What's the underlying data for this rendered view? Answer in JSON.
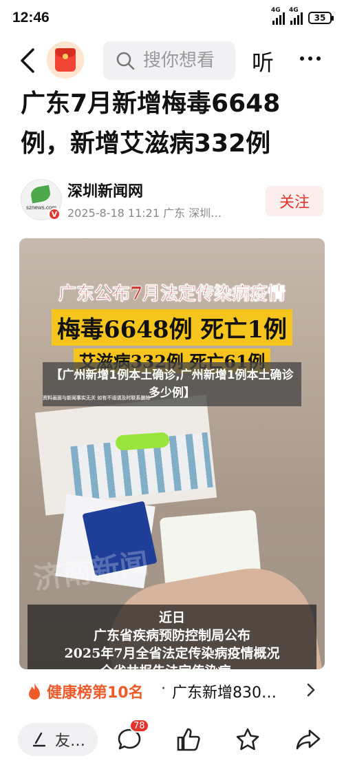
{
  "status_bar": {
    "time": "12:46",
    "network_1": "4G",
    "network_2": "4G",
    "battery": "35"
  },
  "nav": {
    "search_placeholder": "搜你想看",
    "listen_label": "听"
  },
  "article": {
    "title": "广东7月新增梅毒6648例，新增艾滋病332例",
    "author": {
      "name": "深圳新闻网",
      "avatar_text": "sznews.com",
      "verified_mark": "V",
      "meta": "2025-8-18  11:21  广东  深圳…",
      "follow_label": "关注"
    }
  },
  "media": {
    "overlay_line1": "广东公布7月法定传染病疫情",
    "overlay_line2": "梅毒6648例 死亡1例",
    "overlay_line3": "艾滋病332例 死亡61例",
    "caption": "【广州新增1例本土确诊,广州新增1例本土确诊多少例】",
    "source_note": "资料画面与新闻事实无关 如有不适请及时联系删除",
    "watermark": "济南新闻",
    "subtitle_line1": "近日",
    "subtitle_line2": "广东省疾病预防控制局公布",
    "subtitle_line3": "2025年7月全省法定传染病疫情概况",
    "subtitle_line4": "全省共报告法定传染病…"
  },
  "hot_list": {
    "rank_label": "健康榜第10名",
    "separator": "·",
    "topic": "广东新增830…"
  },
  "bottom_bar": {
    "comment_placeholder": "友…",
    "comment_count": "78"
  },
  "colors": {
    "accent_red": "#e5342c",
    "hot_orange": "#ef5a2a",
    "highlight_yellow": "#f6c51d"
  },
  "icons": [
    "back-arrow-icon",
    "red-packet-icon",
    "search-icon",
    "more-icon",
    "fire-icon",
    "chevron-right-icon",
    "pen-icon",
    "comment-icon",
    "like-icon",
    "star-icon",
    "share-icon"
  ]
}
